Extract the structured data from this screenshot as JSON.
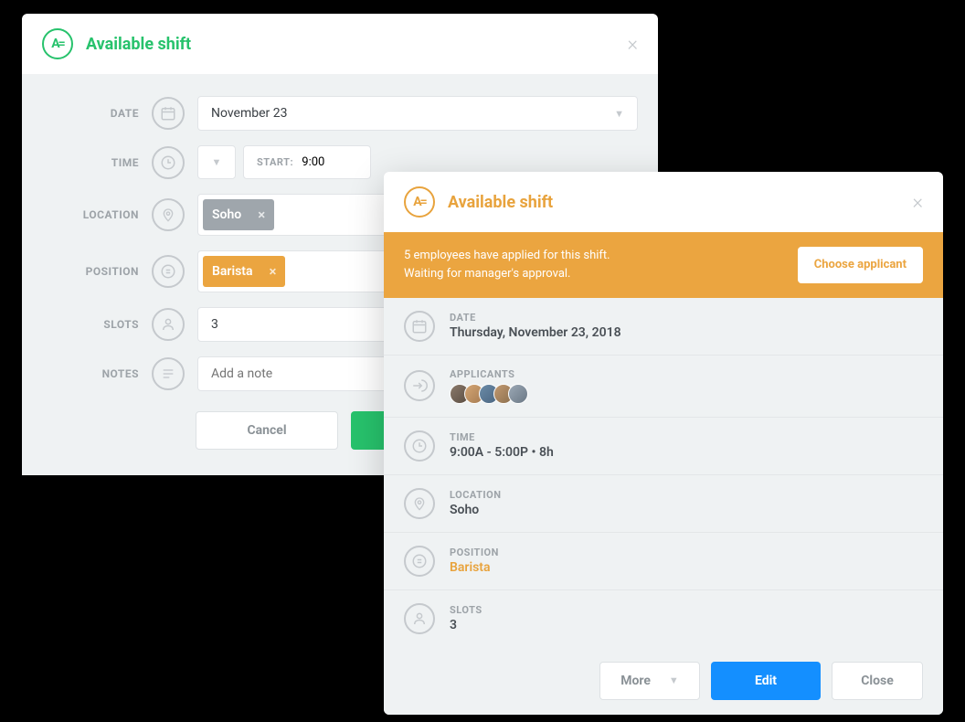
{
  "modal1": {
    "title": "Available shift",
    "fields": {
      "date": {
        "label": "DATE",
        "value": "November 23"
      },
      "time": {
        "label": "TIME",
        "start_label": "START:",
        "start_value": "9:00"
      },
      "location": {
        "label": "LOCATION",
        "chip": "Soho"
      },
      "position": {
        "label": "POSITION",
        "chip": "Barista"
      },
      "slots": {
        "label": "SLOTS",
        "value": "3"
      },
      "notes": {
        "label": "NOTES",
        "placeholder": "Add a note"
      }
    },
    "buttons": {
      "cancel": "Cancel"
    }
  },
  "modal2": {
    "title": "Available shift",
    "banner": {
      "line1": "5 employees have applied for this shift.",
      "line2": "Waiting for manager's approval.",
      "button": "Choose applicant"
    },
    "info": {
      "date": {
        "label": "DATE",
        "value": "Thursday, November 23, 2018"
      },
      "applicants": {
        "label": "APPLICANTS",
        "count": 5
      },
      "time": {
        "label": "TIME",
        "value": "9:00A - 5:00P • 8h"
      },
      "location": {
        "label": "LOCATION",
        "value": "Soho"
      },
      "position": {
        "label": "POSITION",
        "value": "Barista"
      },
      "slots": {
        "label": "SLOTS",
        "value": "3"
      }
    },
    "buttons": {
      "more": "More",
      "edit": "Edit",
      "close": "Close"
    }
  }
}
